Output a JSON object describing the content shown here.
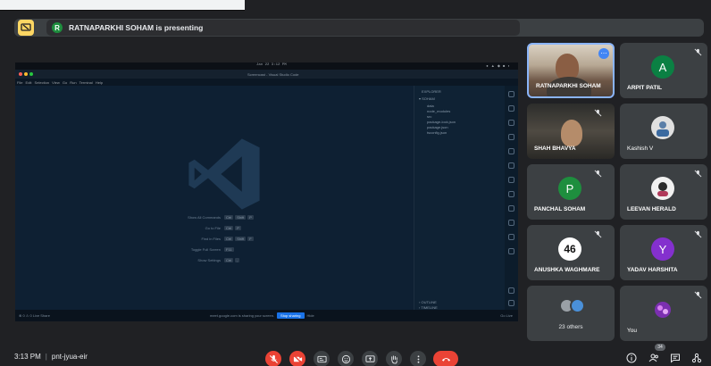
{
  "presenter_bar": {
    "avatar_letter": "R",
    "text": "RATNAPARKHI SOHAM is presenting"
  },
  "shared_screen": {
    "clock": "Jan 22 3:12 PM",
    "window_title": "Screencast - Visual Studio Code",
    "menu": "File Edit Selection View Go Run Terminal Help",
    "shortcuts": [
      {
        "label": "Show All Commands",
        "keys": [
          "Ctrl",
          "Shift",
          "P"
        ]
      },
      {
        "label": "Go to File",
        "keys": [
          "Ctrl",
          "P"
        ]
      },
      {
        "label": "Find in Files",
        "keys": [
          "Ctrl",
          "Shift",
          "F"
        ]
      },
      {
        "label": "Toggle Full Screen",
        "keys": [
          "F11"
        ]
      },
      {
        "label": "Show Settings",
        "keys": [
          "Ctrl",
          ","
        ]
      }
    ],
    "explorer": {
      "header": "EXPLORER",
      "project": "SOHAM",
      "items": [
        "data",
        "node_modules",
        "src",
        "package-lock.json",
        "package.json",
        "tsconfig.json"
      ],
      "outline": "OUTLINE",
      "timeline": "TIMELINE"
    },
    "status_left": "⊗ 0 ⚠ 0   Live Share",
    "sharing_notice": "meet.google.com is sharing your screen.",
    "stop_sharing": "Stop sharing",
    "hide": "Hide",
    "status_right": "Go Live"
  },
  "participants": [
    {
      "name": "RATNAPARKHI SOHAM",
      "kind": "video-pinned"
    },
    {
      "name": "ARPIT PATIL",
      "kind": "avatar",
      "letter": "A",
      "color": "#0b8043"
    },
    {
      "name": "SHAH BHAVYA",
      "kind": "video"
    },
    {
      "name": "Kashish V",
      "kind": "photo"
    },
    {
      "name": "PANCHAL SOHAM",
      "kind": "avatar",
      "letter": "P",
      "color": "#1e8e3e"
    },
    {
      "name": "LEEVAN HERALD",
      "kind": "photo"
    },
    {
      "name": "ANUSHKA WAGHMARE",
      "kind": "avatar",
      "letter": "46",
      "color": "#ffffff"
    },
    {
      "name": "YADAV HARSHITA",
      "kind": "avatar",
      "letter": "Y",
      "color": "#8430ce"
    },
    {
      "name": "23 others",
      "kind": "group"
    },
    {
      "name": "You",
      "kind": "photo"
    }
  ],
  "footer": {
    "time": "3:13 PM",
    "meeting_code": "pnt-jyua-eir",
    "people_count": "34"
  },
  "colors": {
    "background": "#202124",
    "tile": "#3c4043",
    "danger": "#ea4335",
    "accent": "#fdd663"
  }
}
